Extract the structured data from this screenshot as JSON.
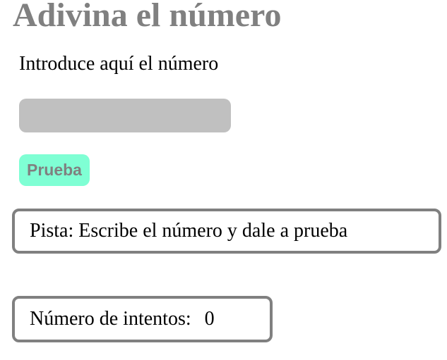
{
  "page": {
    "title": "Adivina el número"
  },
  "form": {
    "prompt_label": "Introduce aquí el número",
    "input_value": "",
    "input_placeholder": "",
    "button_label": "Prueba"
  },
  "hint": {
    "text": "Pista: Escribe el número y dale a prueba"
  },
  "attempts": {
    "label": "Número de intentos:",
    "count": "0"
  },
  "colors": {
    "title": "#808080",
    "input_background": "#c0c0c0",
    "button_background": "#7fffd4",
    "button_text": "#808080",
    "box_border": "#808080",
    "body_text": "#000000"
  }
}
